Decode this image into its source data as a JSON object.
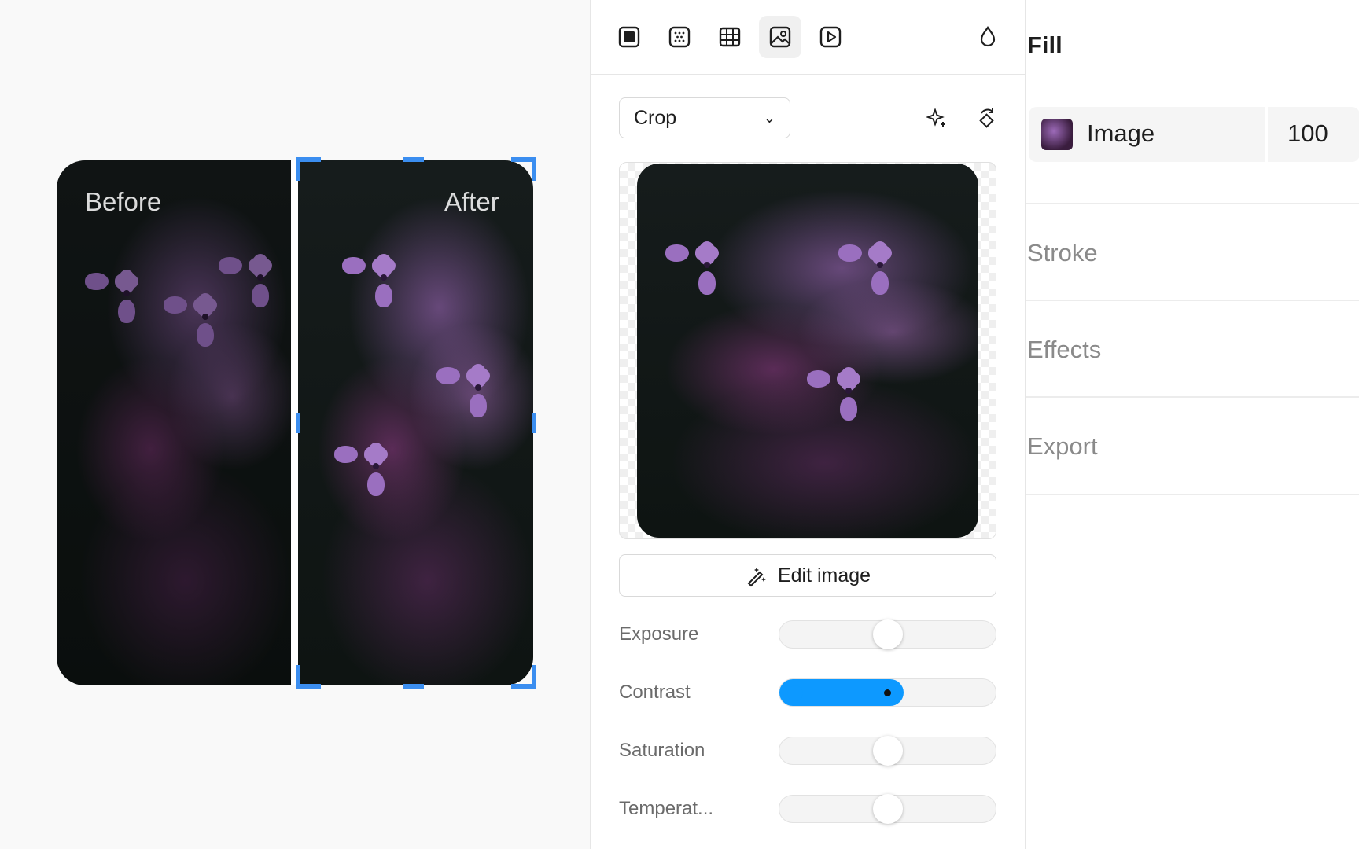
{
  "canvas": {
    "before_label": "Before",
    "after_label": "After"
  },
  "panel": {
    "tabs": [
      {
        "icon": "frame-icon",
        "active": false
      },
      {
        "icon": "noise-icon",
        "active": false
      },
      {
        "icon": "grid-icon",
        "active": false
      },
      {
        "icon": "image-icon",
        "active": true
      },
      {
        "icon": "video-icon",
        "active": false
      }
    ],
    "tint_icon": "drop-icon",
    "mode_select": {
      "value": "Crop"
    },
    "ai_icon": "sparkle-icon",
    "rotate_icon": "rotate-icon",
    "edit_button": "Edit image",
    "adjustments": [
      {
        "label": "Exposure",
        "value": 0
      },
      {
        "label": "Contrast",
        "value": 0.5
      },
      {
        "label": "Saturation",
        "value": 0
      },
      {
        "label": "Temperat...",
        "value": 0
      }
    ]
  },
  "right_panel": {
    "fill_title": "Fill",
    "fill_type": "Image",
    "fill_opacity": "100",
    "sections": [
      "Stroke",
      "Effects",
      "Export"
    ]
  }
}
